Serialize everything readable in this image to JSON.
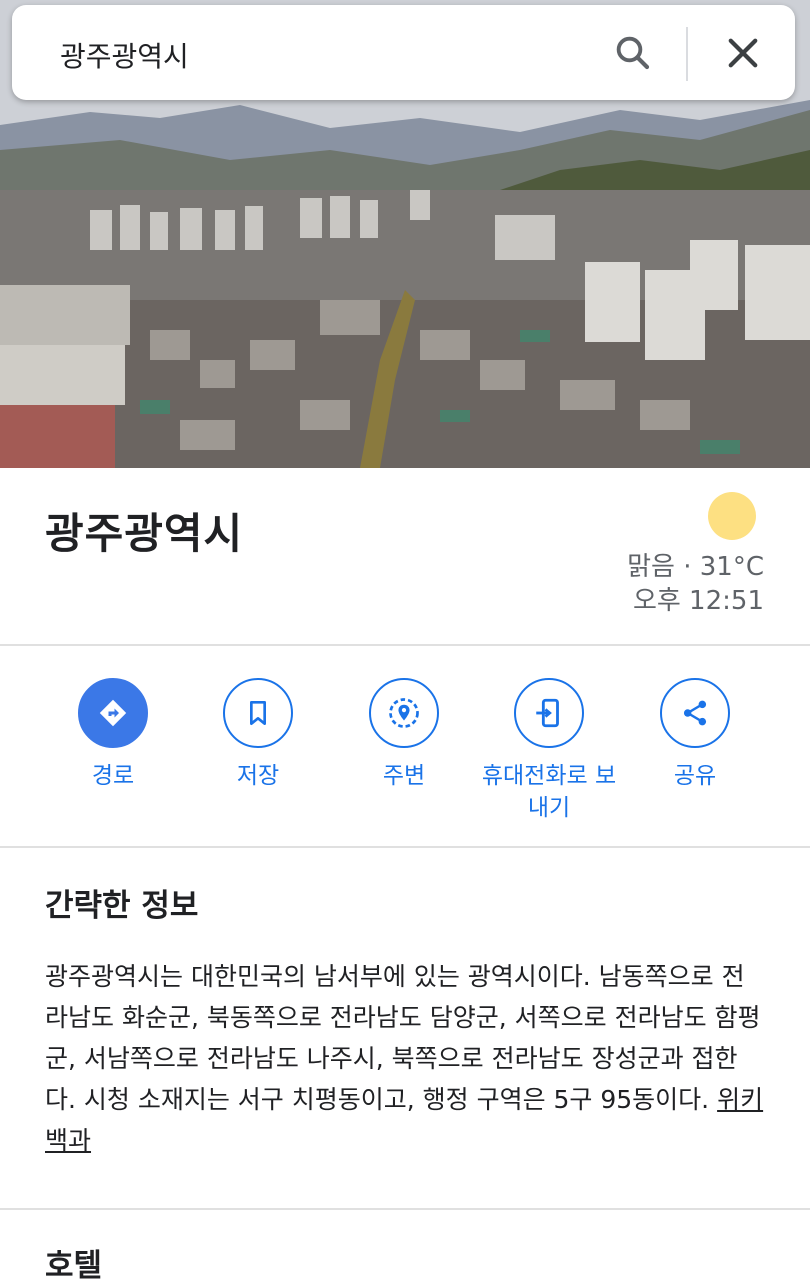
{
  "search": {
    "query": "광주광역시"
  },
  "place": {
    "title": "광주광역시",
    "weather": {
      "condition_temp": "맑음 · 31°C",
      "time": "오후 12:51",
      "icon": "sun-icon"
    }
  },
  "actions": [
    {
      "label": "경로",
      "icon": "directions-icon"
    },
    {
      "label": "저장",
      "icon": "bookmark-icon"
    },
    {
      "label": "주변",
      "icon": "nearby-icon"
    },
    {
      "label": "휴대전화로 보내기",
      "icon": "send-to-phone-icon"
    },
    {
      "label": "공유",
      "icon": "share-icon"
    }
  ],
  "info": {
    "heading": "간략한 정보",
    "text": "광주광역시는 대한민국의 남서부에 있는 광역시이다. 남동쪽으로 전라남도 화순군, 북동쪽으로 전라남도 담양군, 서쪽으로 전라남도 함평군, 서남쪽으로 전라남도 나주시, 북쪽으로 전라남도 장성군과 접한다. 시청 소재지는 서구 치평동이고, 행정 구역은 5구 95동이다.",
    "source_link": "위키백과"
  },
  "next_section": {
    "heading": "호텔"
  },
  "colors": {
    "accent": "#1a73e8",
    "sun": "#fde082"
  }
}
